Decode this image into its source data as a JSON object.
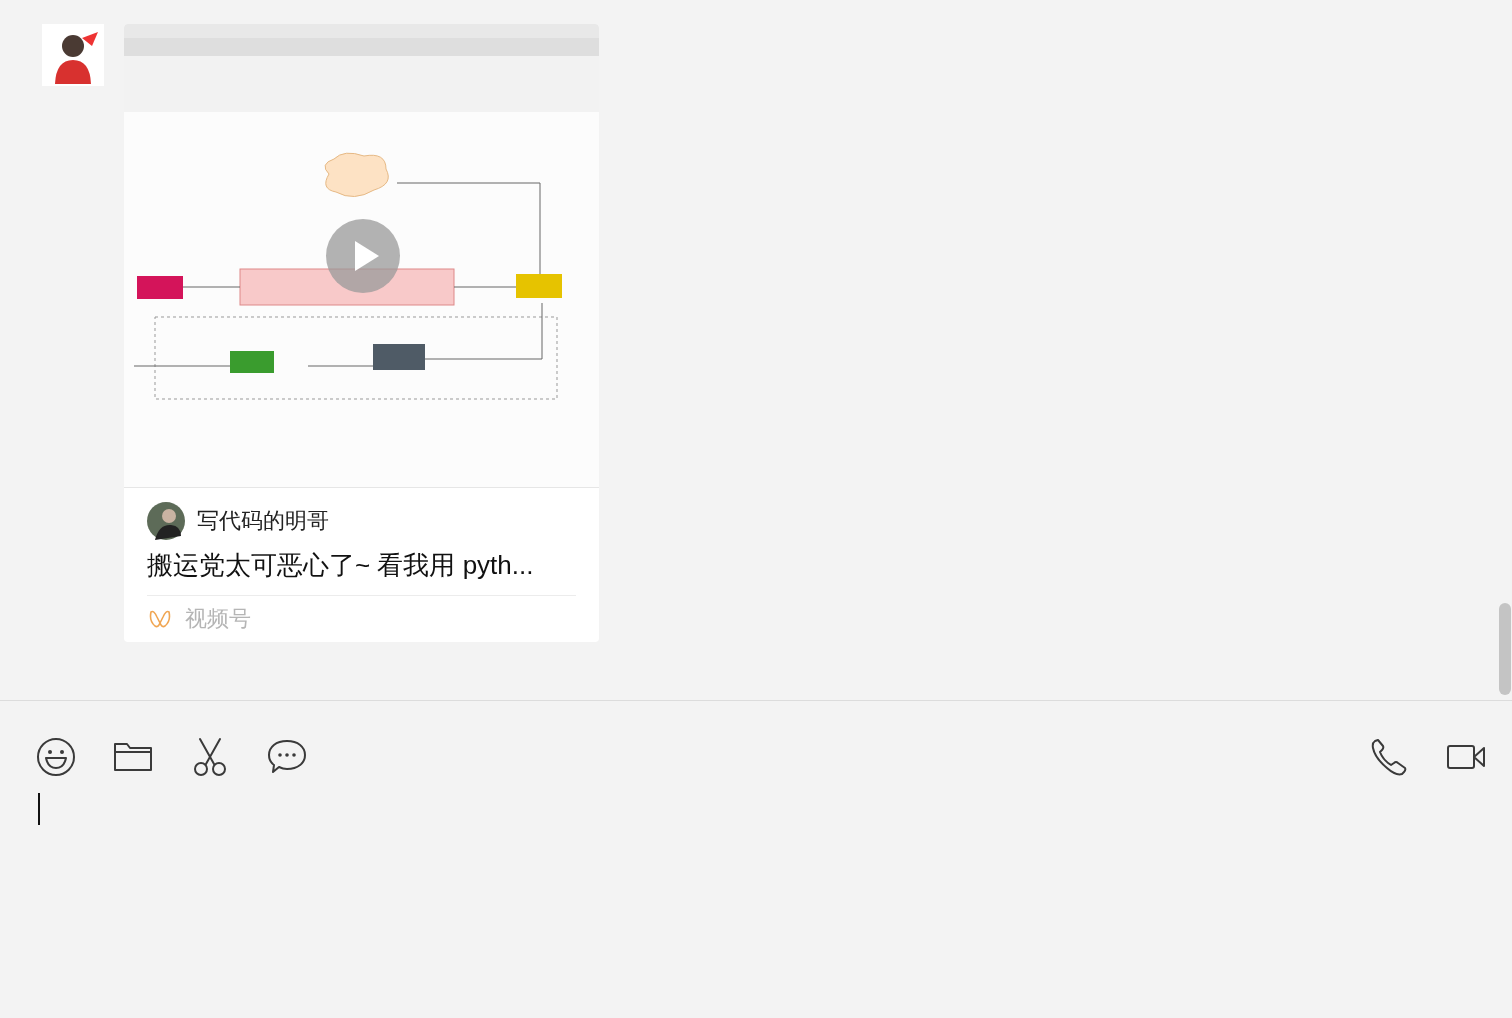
{
  "messages": [
    {
      "kind": "video_card",
      "author": "写代码的明哥",
      "title": "搬运党太可恶心了~ 看我用 pyth...",
      "source": "视频号"
    }
  ],
  "composer": {
    "focused": true
  }
}
